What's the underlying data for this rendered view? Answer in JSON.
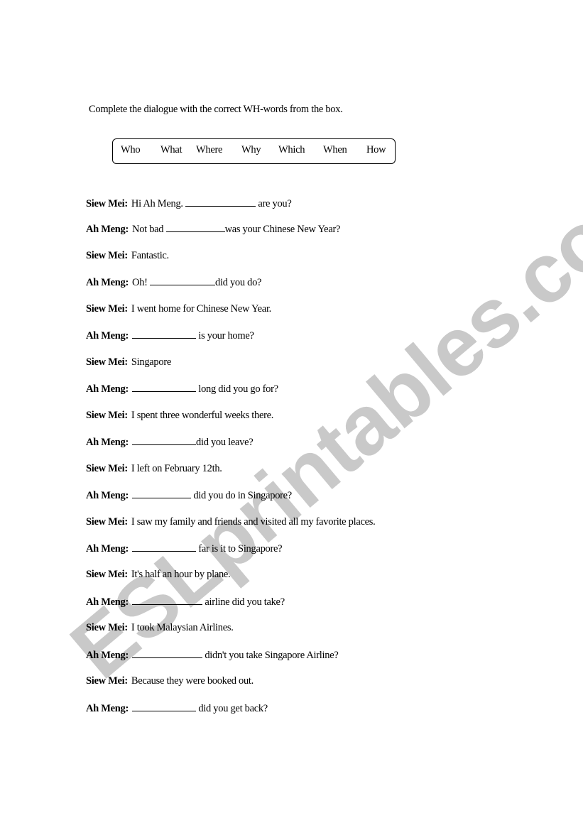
{
  "watermark": "ESLprintables.com",
  "instruction": "Complete the dialogue with the correct WH-words from the box.",
  "word_box": [
    "Who",
    "What",
    "Where",
    "Why",
    "Which",
    "When",
    "How"
  ],
  "dialogue": [
    {
      "speaker": "Siew Mei:",
      "before": "Hi Ah Meng.",
      "blank": true,
      "after": " are you?"
    },
    {
      "speaker": "Ah Meng:",
      "before": "Not bad",
      "blank": true,
      "after": "was your Chinese New Year?"
    },
    {
      "speaker": "Siew Mei:",
      "before": "Fantastic.",
      "blank": false,
      "after": ""
    },
    {
      "speaker": "Ah Meng:",
      "before": "Oh!",
      "blank": true,
      "after": "did you do?"
    },
    {
      "speaker": "Siew Mei:",
      "before": "I went home for Chinese New Year.",
      "blank": false,
      "after": ""
    },
    {
      "speaker": "Ah Meng:",
      "before": "",
      "blank": true,
      "after": " is your home?"
    },
    {
      "speaker": "Siew Mei:",
      "before": "Singapore",
      "blank": false,
      "after": ""
    },
    {
      "speaker": "Ah Meng:",
      "before": "",
      "blank": true,
      "after": " long did you go for?"
    },
    {
      "speaker": "Siew Mei:",
      "before": "I spent three wonderful weeks there.",
      "blank": false,
      "after": ""
    },
    {
      "speaker": "Ah Meng:",
      "before": "",
      "blank": true,
      "after": "did you leave?"
    },
    {
      "speaker": "Siew Mei:",
      "before": "I left on February 12th.",
      "blank": false,
      "after": ""
    },
    {
      "speaker": "Ah Meng:",
      "before": "",
      "blank": true,
      "after": " did you do in Singapore?"
    },
    {
      "speaker": "Siew Mei:",
      "before": "I saw my family and friends and visited all my favorite places.",
      "blank": false,
      "after": ""
    },
    {
      "speaker": "Ah Meng:",
      "before": "",
      "blank": true,
      "after": " far is it to Singapore?"
    },
    {
      "speaker": "Siew Mei:",
      "before": "It's half an hour by plane.",
      "blank": false,
      "after": ""
    },
    {
      "speaker": "Ah Meng:",
      "before": "",
      "blank": true,
      "after": " airline did you take?"
    },
    {
      "speaker": "Siew Mei:",
      "before": "I took Malaysian Airlines.",
      "blank": false,
      "after": ""
    },
    {
      "speaker": "Ah Meng:",
      "before": "",
      "blank": true,
      "after": " didn't you take Singapore Airline?"
    },
    {
      "speaker": "Siew Mei:",
      "before": "Because they were booked out.",
      "blank": false,
      "after": ""
    },
    {
      "speaker": "Ah Meng:",
      "before": "",
      "blank": true,
      "after": " did you get back?"
    }
  ]
}
